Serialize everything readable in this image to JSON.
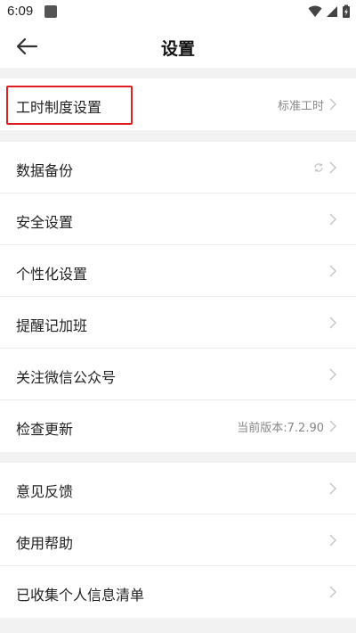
{
  "status_bar": {
    "time": "6:09",
    "icons": [
      "wifi-icon",
      "signal-icon",
      "battery-charging-icon"
    ]
  },
  "header": {
    "title": "设置",
    "back_icon": "arrow-left-icon"
  },
  "groups": [
    {
      "items": [
        {
          "label": "工时制度设置",
          "value": "标准工时",
          "highlighted": true
        }
      ]
    },
    {
      "items": [
        {
          "label": "数据备份",
          "value": "",
          "icon": "sync-icon"
        },
        {
          "label": "安全设置",
          "value": ""
        },
        {
          "label": "个性化设置",
          "value": ""
        },
        {
          "label": "提醒记加班",
          "value": ""
        },
        {
          "label": "关注微信公众号",
          "value": ""
        },
        {
          "label": "检查更新",
          "value": "当前版本:7.2.90"
        }
      ]
    },
    {
      "items": [
        {
          "label": "意见反馈",
          "value": ""
        },
        {
          "label": "使用帮助",
          "value": ""
        },
        {
          "label": "已收集个人信息清单",
          "value": ""
        }
      ]
    }
  ],
  "colors": {
    "background": "#f2f2f2",
    "card": "#ffffff",
    "highlight": "#e02020",
    "secondary_text": "#888888"
  }
}
